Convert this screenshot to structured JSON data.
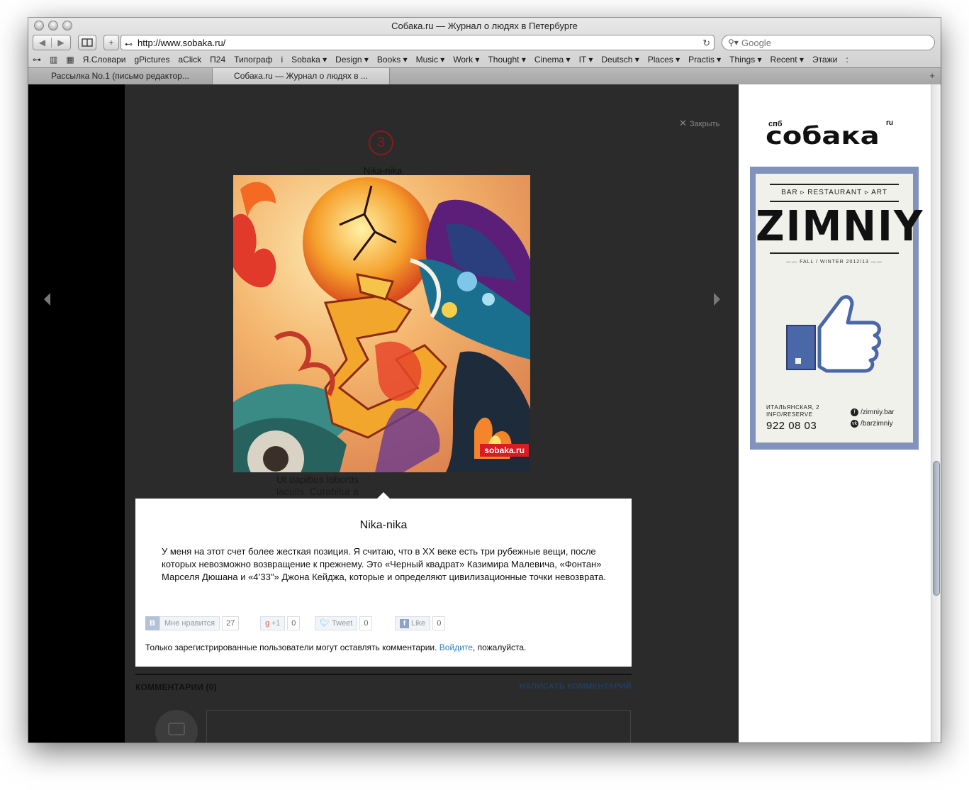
{
  "window": {
    "title": "Собака.ru — Журнал о людях в Петербурге"
  },
  "toolbar": {
    "back_label": "◀",
    "forward_label": "▶",
    "add_label": "+",
    "url": "http://www.sobaka.ru/",
    "search_placeholder": "Google"
  },
  "bookmarks": [
    "Я.Словари",
    "gPictures",
    "aClick",
    "П24",
    "Типограф",
    "i",
    "Sobaka ▾",
    "Design ▾",
    "Books ▾",
    "Music ▾",
    "Work ▾",
    "Thought ▾",
    "Cinema ▾",
    "IT ▾",
    "Deutsch ▾",
    "Places ▾",
    "Practis ▾",
    "Things ▾",
    "Recent ▾",
    "Этажи",
    ":"
  ],
  "tabs": [
    {
      "label": "Рассылка No.1 (письмо редактор...",
      "active": false
    },
    {
      "label": "Собака.ru — Журнал о людях в ...",
      "active": true
    }
  ],
  "gallery": {
    "close_label": "Закрыть",
    "slide_number": "3",
    "slide_title": "Nika-nika",
    "caption": "Ut dapibus lobortis iaculis. Curabitur a",
    "image_badge": "sobaka.ru"
  },
  "popup": {
    "title": "Nika-nika",
    "body": "У меня на этот счет более жесткая позиция. Я считаю, что в XX веке есть три рубежные вещи, после которых невозможно возвращение к прежнему. Это «Черный квадрат» Казимира Малевича, «Фонтан» Марселя Дюшана и «4’33\"» Джона Кейджа, которые и определяют цивилизационные точки невозврата.",
    "social": {
      "vk_label": "Мне нравится",
      "vk_count": "27",
      "gplus_label": "+1",
      "gplus_count": "0",
      "tweet_label": "Tweet",
      "tweet_count": "0",
      "like_label": "Like",
      "like_count": "0"
    },
    "note_before": "Только зарегистрированные пользователи могут оставлять комментарии. ",
    "note_link": "Войдите",
    "note_after": ", пожалуйста."
  },
  "comments": {
    "title": "КОММЕНТАРИИ (0)",
    "write_label": "НАПИСАТЬ КОММЕНТАРИЙ"
  },
  "sidebar": {
    "logo_spb": "спб",
    "logo_word": "собака",
    "logo_ru": "ru",
    "ad": {
      "tagline": "BAR ▹ RESTAURANT ▹ ART",
      "name": "ZIMNIY",
      "season": "—— FALL / WINTER 2012/13 ——",
      "address": "ИТАЛЬЯНСКАЯ, 2",
      "info": "INFO/RESERVE",
      "phone": "922 08 03",
      "facebook": "/zimniy.bar",
      "vk": "/barzimniy"
    }
  },
  "colors": {
    "page_dark": "#2b2b2b",
    "accent_red": "#8a1a1a",
    "link_blue": "#2f7fc1",
    "ad_frame": "#8193bd",
    "thumb_blue": "#4a67a8"
  }
}
